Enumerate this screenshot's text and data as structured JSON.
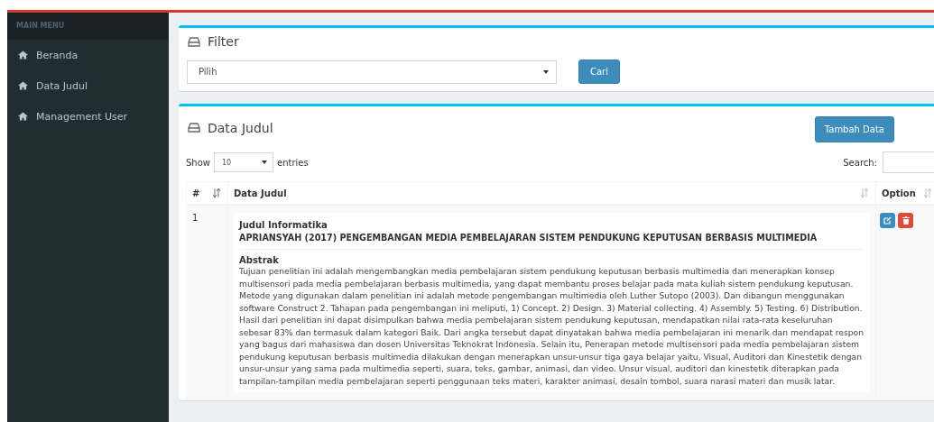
{
  "sidebar": {
    "header": "MAIN MENU",
    "items": [
      {
        "label": "Beranda"
      },
      {
        "label": "Data Judul"
      },
      {
        "label": "Management User"
      }
    ]
  },
  "filter": {
    "title": "Filter",
    "select": {
      "value": "Pilih"
    },
    "button": "Cari"
  },
  "data_panel": {
    "title": "Data Judul",
    "add_button": "Tambah Data",
    "show_label": "Show",
    "page_size": "10",
    "entries_label": "entries",
    "search_label": "Search:",
    "table": {
      "columns": [
        "#",
        "Data Judul",
        "Option"
      ],
      "rows": [
        {
          "number": "1",
          "category": "Judul Informatika",
          "title": "APRIANSYAH (2017) PENGEMBANGAN MEDIA PEMBELAJARAN SISTEM PENDUKUNG KEPUTUSAN BERBASIS MULTIMEDIA",
          "abstract_label": "Abstrak",
          "abstract": "Tujuan penelitian ini adalah mengembangkan media pembelajaran sistem pendukung keputusan berbasis multimedia dan menerapkan konsep multisensori pada media pembelajaran berbasis multimedia, yang dapat membantu proses belajar pada mata kuliah sistem pendukung keputusan. Metode yang digunakan dalam penelitian ini adalah metode pengembangan multimedia oleh Luther Sutopo (2003). Dan dibangun menggunakan software Construct 2. Tahapan pada pengembangan ini meliputi, 1) Concept. 2) Design. 3) Material collecting. 4) Assembly. 5) Testing. 6) Distribution. Hasil dari penelitian ini dapat disimpulkan bahwa media pembelajaran sistem pendukung keputusan, mendapatkan nilai rata-rata keseluruhan sebesar 83% dan termasuk dalam kategori Baik. Dari angka tersebut dapat dinyatakan bahwa media pembelajaran ini menarik dan mendapat respon yang bagus dari mahasiswa dan dosen Universitas Teknokrat Indonesia. Selain itu, Penerapan metode multisensori pada media pembelajaran sistem pendukung keputusan berbasis multimedia dilakukan dengan menerapkan unsur-unsur tiga gaya belajar yaitu, Visual, Auditori dan Kinestetik dengan unsur-unsur yang sama pada multimedia seperti, suara, teks, gambar, animasi, dan video. Unsur visual, auditori dan kinestetik diterapkan pada tampilan-tampilan media pembelajaran seperti penggunaan teks materi, karakter animasi, desain tombol, suara narasi materi dan musik latar."
        }
      ]
    }
  }
}
